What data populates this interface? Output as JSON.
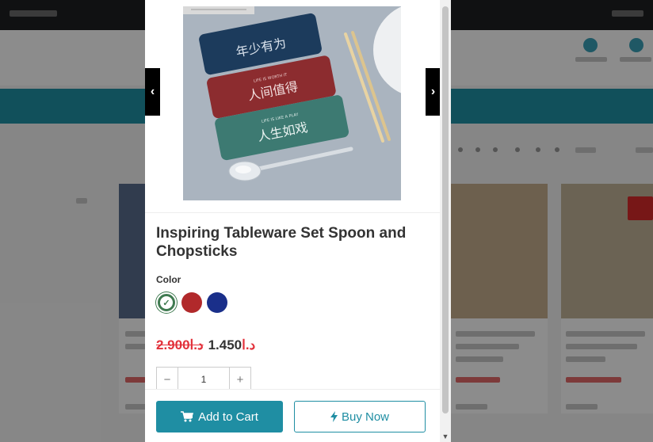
{
  "product": {
    "title": "Inspiring Tableware Set Spoon and Chopsticks",
    "color_label": "Color",
    "colors": [
      {
        "name": "green",
        "hex": "#3f7a50",
        "selected": true
      },
      {
        "name": "red",
        "hex": "#b1292b",
        "selected": false
      },
      {
        "name": "blue",
        "hex": "#1a2f8a",
        "selected": false
      }
    ],
    "old_price": "2.900",
    "old_currency": "د.ا",
    "new_price": "1.450",
    "new_currency": "د.ا",
    "quantity": "1"
  },
  "gallery": {
    "prev_glyph": "‹",
    "next_glyph": "›",
    "case_texts": [
      "年少有为",
      "人间值得",
      "人生如戏"
    ],
    "case_subtexts": [
      "",
      "LIFE IS WORTH IT",
      "LIFE IS LIKE A PLAY"
    ]
  },
  "actions": {
    "add_to_cart": "Add to Cart",
    "buy_now": "Buy Now"
  },
  "quantity_controls": {
    "minus": "−",
    "plus": "+"
  },
  "colors": {
    "accent": "#1f8ea3",
    "sale": "#e2303a"
  }
}
